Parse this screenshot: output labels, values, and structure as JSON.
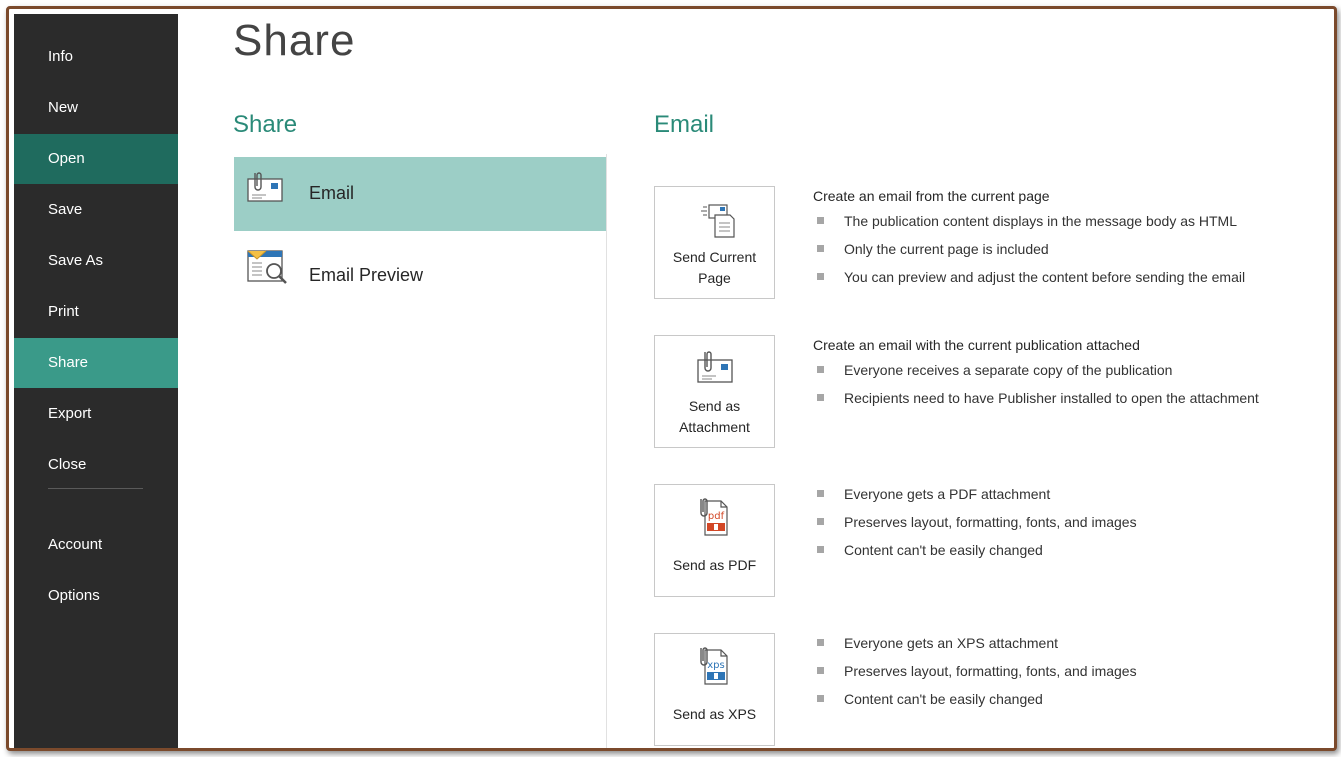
{
  "sidebar": {
    "items": [
      {
        "label": "Info"
      },
      {
        "label": "New"
      },
      {
        "label": "Open"
      },
      {
        "label": "Save"
      },
      {
        "label": "Save As"
      },
      {
        "label": "Print"
      },
      {
        "label": "Share"
      },
      {
        "label": "Export"
      },
      {
        "label": "Close"
      },
      {
        "label": "Account"
      },
      {
        "label": "Options"
      }
    ],
    "selected": "Share"
  },
  "main": {
    "title": "Share",
    "share_heading": "Share",
    "email_heading": "Email",
    "share_options": [
      {
        "label": "Email",
        "icon": "email-attachment-icon",
        "selected": true
      },
      {
        "label": "Email Preview",
        "icon": "email-preview-icon",
        "selected": false
      }
    ],
    "actions": [
      {
        "label_line1": "Send Current",
        "label_line2": "Page",
        "icon": "send-page-icon",
        "description": "Create an email from the current page",
        "bullets": [
          "The publication content displays in the message body as HTML",
          "Only the current page is included",
          "You can preview and adjust the content before sending the email"
        ]
      },
      {
        "label_line1": "Send as",
        "label_line2": "Attachment",
        "icon": "email-attachment-icon",
        "description": "Create an email with the current publication attached",
        "bullets": [
          "Everyone receives a separate copy of the publication",
          "Recipients need to have Publisher installed to open the attachment"
        ]
      },
      {
        "label_line1": "Send as PDF",
        "label_line2": "",
        "icon": "pdf-icon",
        "icon_text": "pdf",
        "description": "",
        "bullets": [
          "Everyone gets a PDF attachment",
          "Preserves layout, formatting, fonts, and images",
          "Content can't be easily changed"
        ]
      },
      {
        "label_line1": "Send as XPS",
        "label_line2": "",
        "icon": "xps-icon",
        "icon_text": "xps",
        "description": "",
        "bullets": [
          "Everyone gets an XPS attachment",
          "Preserves layout, formatting, fonts, and images",
          "Content can't be easily changed"
        ]
      }
    ]
  },
  "colors": {
    "sidebar_bg": "#2b2b2b",
    "open_highlight": "#1f6b5e",
    "share_highlight": "#3a9a89",
    "selected_option": "#9ccec6",
    "heading_accent": "#2a8a78",
    "frame_border": "#7b4a2c",
    "pdf_red": "#d24726",
    "xps_blue": "#2e75b6"
  }
}
